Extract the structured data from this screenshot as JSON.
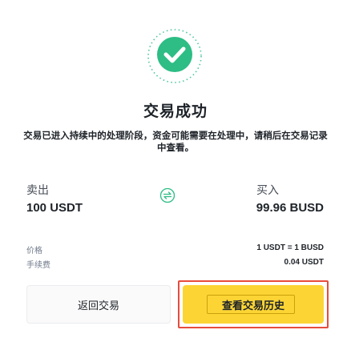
{
  "status": {
    "title": "交易成功",
    "description": "交易已进入持续中的处理阶段，资金可能需要在处理中，请稍后在交易记录中查看。",
    "icon": "check-circle-icon"
  },
  "sell": {
    "label": "卖出",
    "amount": "100 USDT"
  },
  "buy": {
    "label": "买入",
    "amount": "99.96 BUSD"
  },
  "swap_icon": "swap-arrows-icon",
  "details": {
    "price_label": "价格",
    "price_value": "1 USDT = 1 BUSD",
    "fee_label": "手续费",
    "fee_value": "0.04 USDT"
  },
  "actions": {
    "back_label": "返回交易",
    "history_label": "查看交易历史"
  },
  "colors": {
    "success": "#2dbd85",
    "accent": "#fcd535",
    "highlight": "#e74c3c"
  }
}
